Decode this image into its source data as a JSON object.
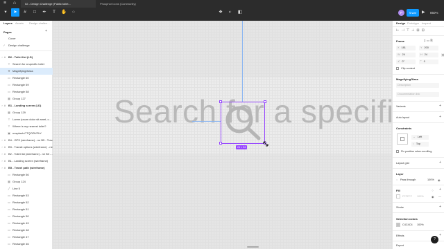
{
  "topbar": {
    "tabs": [
      {
        "label": "02 - Design Challenge (Public toilet..."
      },
      {
        "label": "Phosphor Icons (Community)"
      }
    ],
    "tools": [
      "move-icon",
      "frame-icon",
      "shape-icon",
      "pen-icon",
      "text-icon",
      "hand-icon",
      "comment-icon"
    ],
    "avatar": "P",
    "play": "▶",
    "share_label": "Share",
    "zoom_label": "850%"
  },
  "left": {
    "tabs": [
      "Layers",
      "Assets"
    ],
    "page_tab": "Design challen...",
    "pages_header": "Pages",
    "pages": [
      "Cover",
      "Design challenge"
    ],
    "layers": [
      {
        "label": "B2 - Toilet list (LD)",
        "bold": true,
        "indent": 0,
        "icon": "#"
      },
      {
        "label": "Search for a specific toilet",
        "indent": 1,
        "icon": "T"
      },
      {
        "label": "MagnifyingGlass",
        "indent": 1,
        "icon": "❖",
        "selected": true
      },
      {
        "label": "Rectangle 60",
        "indent": 1,
        "icon": "▭"
      },
      {
        "label": "Rectangle 59",
        "indent": 1,
        "icon": "▭"
      },
      {
        "label": "Rectangle 58",
        "indent": 1,
        "icon": "▭"
      },
      {
        "label": "Group 127",
        "indent": 1,
        "icon": "▦"
      },
      {
        "label": "B1 - Landing screen (LD)",
        "bold": true,
        "indent": 0,
        "icon": "#"
      },
      {
        "label": "Group 129",
        "indent": 1,
        "icon": "▦"
      },
      {
        "label": "Lorem ipsum dolor sit amet, c...",
        "indent": 1,
        "icon": "T"
      },
      {
        "label": "Where is my nearest toilet?",
        "indent": 1,
        "icon": "T"
      },
      {
        "label": "unsplash:CTQOZfVFkY",
        "indent": 1,
        "icon": "▣"
      },
      {
        "label": "B4 - GPS (wireframe) - no B5 - Trav...",
        "indent": 0,
        "icon": "#"
      },
      {
        "label": "B3 - Transit options (wireframe) - ne...",
        "indent": 0,
        "icon": "#"
      },
      {
        "label": "B2 - Toilet list (wireframe) - ne B3 -...",
        "indent": 0,
        "icon": "#"
      },
      {
        "label": "B1 - Landing screen (wireframe)",
        "indent": 0,
        "icon": "#"
      },
      {
        "label": "B5 - Travel path (wireframe)",
        "bold": true,
        "indent": 0,
        "icon": "#"
      },
      {
        "label": "Rectangle 56",
        "indent": 1,
        "icon": "▭"
      },
      {
        "label": "Group 124",
        "indent": 1,
        "icon": "▦"
      },
      {
        "label": "Line 5",
        "indent": 1,
        "icon": "╱"
      },
      {
        "label": "Rectangle 53",
        "indent": 1,
        "icon": "▭"
      },
      {
        "label": "Rectangle 52",
        "indent": 1,
        "icon": "▭"
      },
      {
        "label": "Rectangle 51",
        "indent": 1,
        "icon": "▭"
      },
      {
        "label": "Rectangle 50",
        "indent": 1,
        "icon": "▭"
      },
      {
        "label": "Rectangle 49",
        "indent": 1,
        "icon": "▭"
      },
      {
        "label": "Rectangle 48",
        "indent": 1,
        "icon": "▭"
      },
      {
        "label": "Rectangle 47",
        "indent": 1,
        "icon": "▭"
      },
      {
        "label": "Rectangle 46",
        "indent": 1,
        "icon": "▭"
      }
    ]
  },
  "canvas": {
    "big_text": "Search for a specific",
    "size_badge": "24 × 24"
  },
  "right": {
    "tabs": [
      "Design",
      "Prototype",
      "Inspect"
    ],
    "frame_header": "Frame",
    "x_label": "X",
    "x_value": "181",
    "y_label": "Y",
    "y_value": "200",
    "w_label": "W",
    "w_value": "24",
    "h_label": "H",
    "h_value": "24",
    "rotation_value": "0°",
    "radius_value": "0",
    "clip_content_label": "Clip content",
    "component_name": "MagnifyingGlass",
    "description_placeholder": "Description",
    "doc_link_placeholder": "Documentation link",
    "variants_label": "Variants",
    "auto_layout_label": "Auto layout",
    "constraints_header": "Constraints",
    "constraint_h": "Left",
    "constraint_v": "Top",
    "fix_scrolling_label": "Fix position when scrolling",
    "layout_grid_label": "Layout grid",
    "layer_header": "Layer",
    "blend_mode": "Pass through",
    "layer_opacity": "100%",
    "fill_header": "Fill",
    "fill_hex": "FFFFFF",
    "fill_opacity": "100%",
    "stroke_label": "Stroke",
    "selection_colors_header": "Selection colors",
    "sel_color_hex": "C4C4C4",
    "sel_color_opacity": "100%",
    "effects_label": "Effects",
    "export_label": "Export"
  },
  "help_label": "?"
}
